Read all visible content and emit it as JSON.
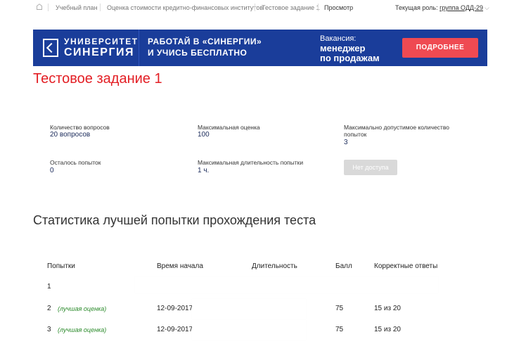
{
  "nav": {
    "crumbs": [
      "Учебный план",
      "Оценка стоимости кредитно-финансовых институтов",
      "Тестовое задание 1",
      "Просмотр"
    ],
    "role_label": "Текущая роль:",
    "role_value": "группа ОДД-29"
  },
  "banner": {
    "logo_line1": "УНИВЕРСИТЕТ",
    "logo_line2": "СИНЕРГИЯ",
    "slogan_line1": "РАБОТАЙ В «СИНЕРГИИ»",
    "slogan_line2": "И УЧИСЬ БЕСПЛАТНО",
    "vacancy_label": "Вакансия:",
    "vacancy_line1": "менеджер",
    "vacancy_line2": "по продажам",
    "button": "ПОДРОБНЕЕ",
    "colors": {
      "background": "#1a3d9a",
      "button": "#ef4a52"
    }
  },
  "page_title": "Тестовое задание 1",
  "info": {
    "questions_label": "Количество вопросов",
    "questions_value": "20 вопросов",
    "max_score_label": "Максимальная оценка",
    "max_score_value": "100",
    "max_attempts_label": "Максимально допустимое количество попыток",
    "max_attempts_value": "3",
    "attempts_left_label": "Осталось попыток",
    "attempts_left_value": "0",
    "max_duration_label": "Максимальная длительность попытки",
    "max_duration_value": "1 ч.",
    "access_button": "Нет доступа"
  },
  "stats": {
    "title": "Статистика лучшей попытки прохождения теста",
    "headers": [
      "Попытки",
      "Время начала",
      "Длительность",
      "Балл",
      "Корректные ответы"
    ],
    "rows": [
      {
        "attempt": "1",
        "note": "",
        "start": "",
        "score": "",
        "correct": ""
      },
      {
        "attempt": "2",
        "note": "(лучшая оценка)",
        "start": "12-09-2017",
        "score": "75",
        "correct": "15 из 20"
      },
      {
        "attempt": "3",
        "note": "(лучшая оценка)",
        "start": "12-09-2017",
        "score": "75",
        "correct": "15 из 20"
      }
    ]
  }
}
